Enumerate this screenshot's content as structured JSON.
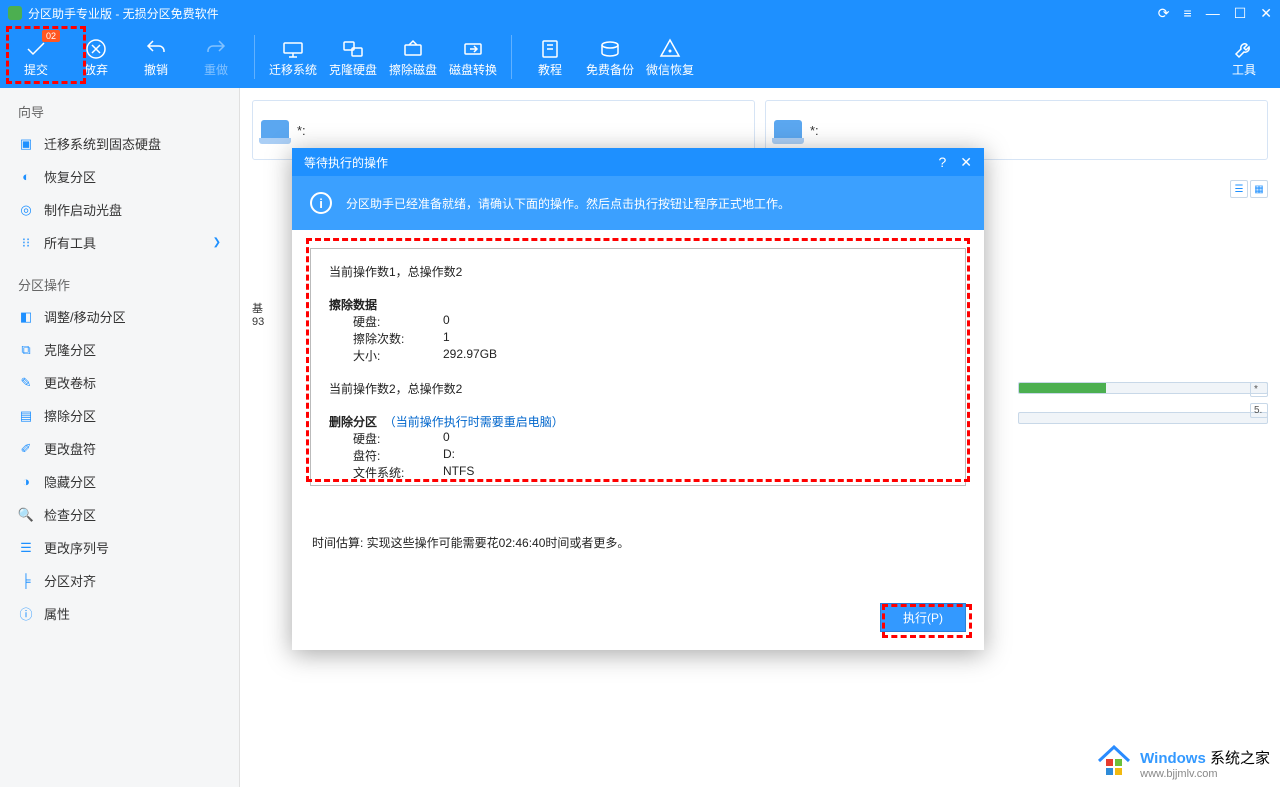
{
  "titlebar": {
    "title": "分区助手专业版 - 无损分区免费软件"
  },
  "toolbar": {
    "submit": "提交",
    "submit_badge": "02",
    "discard": "放弃",
    "undo": "撤销",
    "redo": "重做",
    "migrate": "迁移系统",
    "clone": "克隆硬盘",
    "wipe": "擦除磁盘",
    "convert": "磁盘转换",
    "tutorial": "教程",
    "backup": "免费备份",
    "wechat": "微信恢复",
    "tools": "工具"
  },
  "sidebar": {
    "section1": "向导",
    "items1": [
      "迁移系统到固态硬盘",
      "恢复分区",
      "制作启动光盘",
      "所有工具"
    ],
    "section2": "分区操作",
    "items2": [
      "调整/移动分区",
      "克隆分区",
      "更改卷标",
      "擦除分区",
      "更改盘符",
      "隐藏分区",
      "检查分区",
      "更改序列号",
      "分区对齐",
      "属性"
    ]
  },
  "main_panels": {
    "asterisk": "*:"
  },
  "disk_preview": {
    "label1": "基",
    "label2": "93"
  },
  "progress": {
    "right_labels": [
      "*",
      "5."
    ]
  },
  "modal": {
    "title": "等待执行的操作",
    "info": "分区助手已经准备就绪，请确认下面的操作。然后点击执行按钮让程序正式地工作。",
    "op1_header": "当前操作数1，总操作数2",
    "op1_title": "擦除数据",
    "op1_disk_l": "硬盘:",
    "op1_disk_v": "0",
    "op1_count_l": "擦除次数:",
    "op1_count_v": "1",
    "op1_size_l": "大小:",
    "op1_size_v": "292.97GB",
    "op2_header": "当前操作数2，总操作数2",
    "op2_title": "删除分区",
    "op2_note": "（当前操作执行时需要重启电脑）",
    "op2_disk_l": "硬盘:",
    "op2_disk_v": "0",
    "op2_drive_l": "盘符:",
    "op2_drive_v": "D:",
    "op2_fs_l": "文件系统:",
    "op2_fs_v": "NTFS",
    "time_est": "时间估算: 实现这些操作可能需要花02:46:40时间或者更多。",
    "exec_btn": "执行(P)"
  },
  "watermark": {
    "brand_blue": "Windows",
    "brand_rest": " 系统之家",
    "url": "www.bjjmlv.com"
  }
}
